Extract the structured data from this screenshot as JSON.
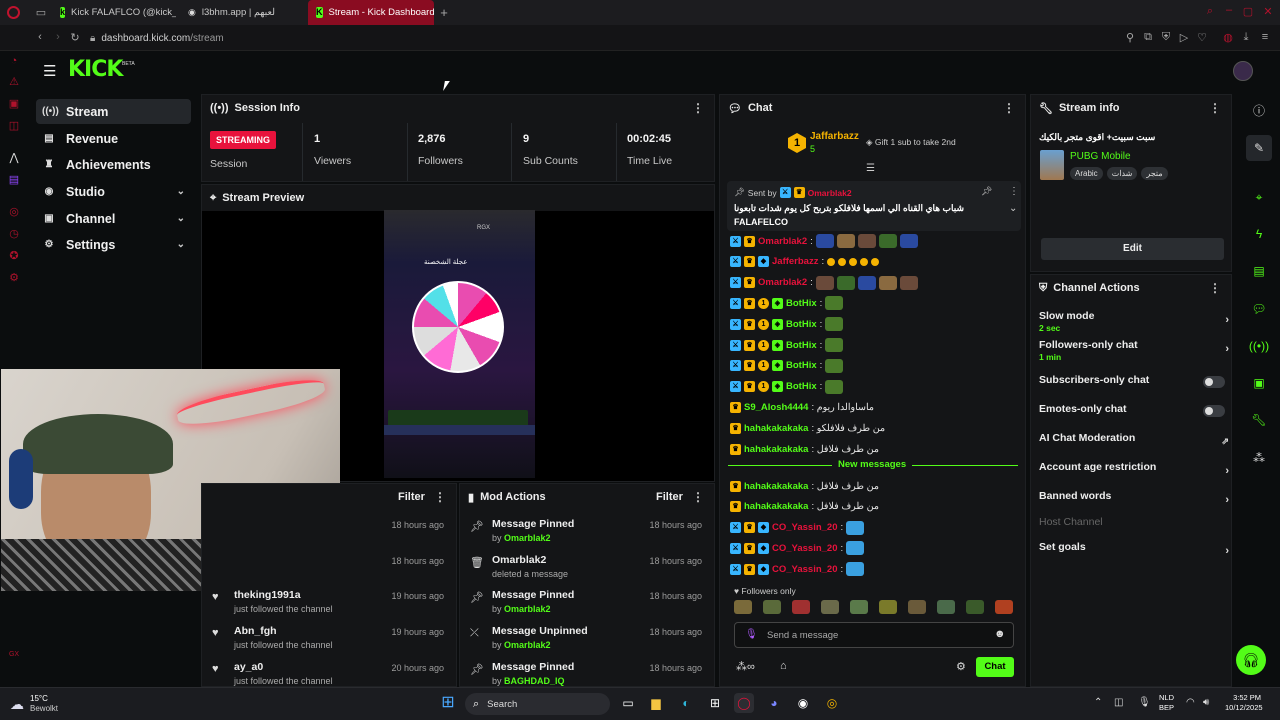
{
  "browser": {
    "tabs": [
      {
        "label": "Kick FALAFLCO (@kick_fa"
      },
      {
        "label": "l3bhm.app | لعبهم"
      },
      {
        "label": "Stream - Kick Dashboard"
      }
    ],
    "url_domain": "dashboard.kick.com",
    "url_path": "/stream"
  },
  "header": {
    "logo": "KICK",
    "beta": "BETA"
  },
  "sidebar": {
    "items": [
      {
        "label": "Stream"
      },
      {
        "label": "Revenue"
      },
      {
        "label": "Achievements"
      },
      {
        "label": "Studio"
      },
      {
        "label": "Channel"
      },
      {
        "label": "Settings"
      }
    ]
  },
  "session": {
    "title": "Session Info",
    "status_badge": "STREAMING",
    "status_label": "Session",
    "stats": [
      {
        "value": "1",
        "label": "Viewers"
      },
      {
        "value": "2,876",
        "label": "Followers"
      },
      {
        "value": "9",
        "label": "Sub Counts"
      },
      {
        "value": "00:02:45",
        "label": "Time Live"
      }
    ]
  },
  "preview": {
    "title": "Stream Preview",
    "wheel_title": "عجلة الشخصنة",
    "overlay_tag": "RGX"
  },
  "activity": {
    "filter": "Filter",
    "items": [
      {
        "title": "",
        "sub": "",
        "time": "18 hours ago"
      },
      {
        "title": "",
        "sub": "",
        "time": "18 hours ago"
      },
      {
        "title": "theking1991a",
        "sub": "just followed the channel",
        "time": "19 hours ago"
      },
      {
        "title": "Abn_fgh",
        "sub": "just followed the channel",
        "time": "19 hours ago"
      },
      {
        "title": "ay_a0",
        "sub": "just followed the channel",
        "time": "20 hours ago"
      }
    ]
  },
  "mod_actions": {
    "title": "Mod Actions",
    "filter": "Filter",
    "items": [
      {
        "title": "Message Pinned",
        "by": "by",
        "user": "Omarblak2",
        "time": "18 hours ago"
      },
      {
        "title": "Omarblak2",
        "by": "deleted a message",
        "user": "",
        "time": "18 hours ago"
      },
      {
        "title": "Message Pinned",
        "by": "by",
        "user": "Omarblak2",
        "time": "18 hours ago"
      },
      {
        "title": "Message Unpinned",
        "by": "by",
        "user": "Omarblak2",
        "time": "18 hours ago"
      },
      {
        "title": "Message Pinned",
        "by": "by",
        "user": "BAGHDAD_IQ",
        "time": "18 hours ago"
      }
    ]
  },
  "chat": {
    "title": "Chat",
    "top_gifter": {
      "name": "Jaffarbazz",
      "rank": "1",
      "count": "5"
    },
    "gift_hint": "Gift 1 sub to take 2nd",
    "pinned": {
      "label": "Sent by",
      "sender": "Omarblak2",
      "text": "شباب هاي القناه الي اسمها فلافلكو بتربح كل يوم شدات تابعونا عليها",
      "text2": "FALAFELCO"
    },
    "messages": [
      {
        "user": "Omarblak2",
        "color": "#e8123c",
        "text": ":"
      },
      {
        "user": "Jafferbazz",
        "color": "#e8123c",
        "text": ":"
      },
      {
        "user": "Omarblak2",
        "color": "#e8123c",
        "text": ":"
      },
      {
        "user": "BotHix",
        "color": "#53fc18",
        "text": ":"
      },
      {
        "user": "BotHix",
        "color": "#53fc18",
        "text": ":"
      },
      {
        "user": "BotHix",
        "color": "#53fc18",
        "text": ":"
      },
      {
        "user": "BotHix",
        "color": "#53fc18",
        "text": ":"
      },
      {
        "user": "BotHix",
        "color": "#53fc18",
        "text": ":"
      },
      {
        "user": "S9_Alosh4444",
        "color": "#53fc18",
        "text": ": ماساوالدا ريوم"
      },
      {
        "user": "hahakakakaka",
        "color": "#53fc18",
        "text": ": من طرف فلافلكو"
      },
      {
        "user": "hahakakakaka",
        "color": "#53fc18",
        "text": ": من طرف فلافل"
      }
    ],
    "new_messages_label": "New messages",
    "new_messages": [
      {
        "user": "hahakakakaka",
        "color": "#53fc18",
        "text": ": من طرف فلافل"
      },
      {
        "user": "hahakakakaka",
        "color": "#53fc18",
        "text": ": من طرف فلافل"
      },
      {
        "user": "CO_Yassin_20",
        "color": "#e8123c",
        "text": ":"
      },
      {
        "user": "CO_Yassin_20",
        "color": "#e8123c",
        "text": ":"
      },
      {
        "user": "CO_Yassin_20",
        "color": "#e8123c",
        "text": ":"
      }
    ],
    "followers_only": "Followers only",
    "input_placeholder": "Send a message",
    "send_label": "Chat"
  },
  "stream_info": {
    "title": "Stream info",
    "stream_title": "سبت سبيت+ اقوى متجر بالكيك",
    "category": "PUBG Mobile",
    "tags": [
      "Arabic",
      "شدات",
      "متجر"
    ],
    "edit_label": "Edit"
  },
  "channel_actions": {
    "title": "Channel Actions",
    "items": [
      {
        "label": "Slow mode",
        "sub": "2 sec"
      },
      {
        "label": "Followers-only chat",
        "sub": "1 min"
      },
      {
        "label": "Subscribers-only chat",
        "sub": ""
      },
      {
        "label": "Emotes-only chat",
        "sub": ""
      },
      {
        "label": "AI Chat Moderation",
        "sub": ""
      },
      {
        "label": "Account age restriction",
        "sub": ""
      },
      {
        "label": "Banned words",
        "sub": ""
      },
      {
        "label": "Host Channel",
        "sub": ""
      },
      {
        "label": "Set goals",
        "sub": ""
      }
    ]
  },
  "taskbar": {
    "weather_temp": "15°C",
    "weather_desc": "Bewolkt",
    "search": "Search",
    "lang": "NLD",
    "lang2": "BEP",
    "time": "3:52 PM",
    "date": "10/12/2025"
  },
  "colors": {
    "accent": "#53fc18",
    "live": "#e8123c",
    "opera": "#b0122c"
  }
}
